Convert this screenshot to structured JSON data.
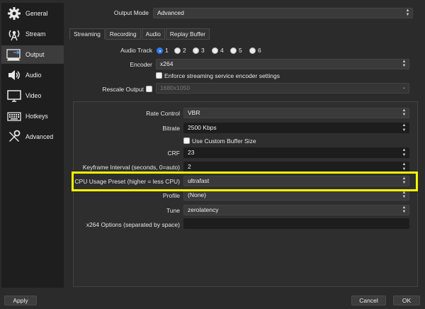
{
  "sidebar": {
    "items": [
      {
        "label": "General",
        "icon": "gear-icon"
      },
      {
        "label": "Stream",
        "icon": "antenna-icon"
      },
      {
        "label": "Output",
        "icon": "monitor-output-icon"
      },
      {
        "label": "Audio",
        "icon": "speaker-icon"
      },
      {
        "label": "Video",
        "icon": "display-icon"
      },
      {
        "label": "Hotkeys",
        "icon": "keyboard-icon"
      },
      {
        "label": "Advanced",
        "icon": "tools-icon"
      }
    ],
    "active": "Output"
  },
  "output_mode": {
    "label": "Output Mode",
    "value": "Advanced"
  },
  "tabs": [
    "Streaming",
    "Recording",
    "Audio",
    "Replay Buffer"
  ],
  "active_tab": "Streaming",
  "audio_track": {
    "label": "Audio Track",
    "options": [
      "1",
      "2",
      "3",
      "4",
      "5",
      "6"
    ],
    "selected": "1"
  },
  "encoder": {
    "label": "Encoder",
    "value": "x264"
  },
  "enforce": {
    "label": "Enforce streaming service encoder settings",
    "checked": false
  },
  "rescale": {
    "label": "Rescale Output",
    "value": "1680x1050",
    "checked": false
  },
  "rate_control": {
    "label": "Rate Control",
    "value": "VBR"
  },
  "bitrate": {
    "label": "Bitrate",
    "value": "2500 Kbps"
  },
  "custom_buffer": {
    "label": "Use Custom Buffer Size",
    "checked": false
  },
  "crf": {
    "label": "CRF",
    "value": "23"
  },
  "keyframe": {
    "label": "Keyframe Interval (seconds, 0=auto)",
    "value": "2"
  },
  "cpu_preset": {
    "label": "CPU Usage Preset (higher = less CPU)",
    "value": "ultrafast"
  },
  "profile": {
    "label": "Profile",
    "value": "(None)"
  },
  "tune": {
    "label": "Tune",
    "value": "zerolatency"
  },
  "x264_options": {
    "label": "x264 Options (separated by space)",
    "value": ""
  },
  "buttons": {
    "apply": "Apply",
    "cancel": "Cancel",
    "ok": "OK"
  },
  "colors": {
    "highlight": "#f7f500",
    "radio_checked": "#2f7cf6",
    "sidebar_bg": "#1e1e1e",
    "active_item": "#3c3c3c"
  }
}
